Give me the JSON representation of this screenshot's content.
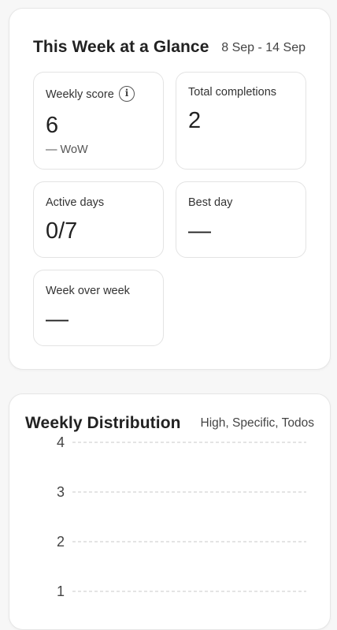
{
  "glance": {
    "title": "This Week at a Glance",
    "date_range": "8 Sep - 14 Sep",
    "tiles": {
      "weekly_score": {
        "label": "Weekly score",
        "value": "6",
        "note": "— WoW",
        "info_icon": "info-icon"
      },
      "total_completions": {
        "label": "Total completions",
        "value": "2"
      },
      "active_days": {
        "label": "Active days",
        "value": "0/7"
      },
      "best_day": {
        "label": "Best day",
        "value": "—"
      },
      "week_over_week": {
        "label": "Week over week",
        "value": "—"
      }
    }
  },
  "distribution": {
    "title": "Weekly Distribution",
    "filter_text": "High, Specific, Todos",
    "chart_data": {
      "type": "bar",
      "title": "Weekly Distribution",
      "y_ticks": [
        "4",
        "3",
        "2",
        "1"
      ],
      "grid": "dashed horizontal",
      "series": []
    }
  },
  "colors": {
    "card_border": "#e6e6e6",
    "grid_line": "#c8c8c8",
    "text": "#222222",
    "muted_text": "#444444"
  }
}
